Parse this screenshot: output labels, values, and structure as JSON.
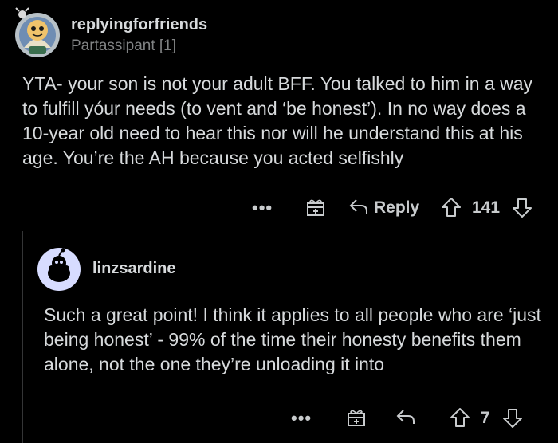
{
  "comment": {
    "username": "replyingforfriends",
    "flair": "Partassipant [1]",
    "text": "YTA- your son is not your adult BFF. You talked to him in a way to fulfill yóur needs (to vent and ‘be honest’). In no way does a 10-year old need to hear this nor will he understand this at his age. You’re the AH because you acted selfishly",
    "actions": {
      "more": "•••",
      "reply_label": "Reply",
      "score": "141"
    }
  },
  "reply": {
    "username": "linzsardine",
    "text": "Such a great point! I think it applies to all people who are ‘just being honest’ - 99% of the time their honesty benefits them alone, not the one they’re unloading it into",
    "actions": {
      "more": "•••",
      "score": "7"
    }
  },
  "colors": {
    "background": "#000000",
    "text": "#d7dadc",
    "muted": "#818384"
  }
}
